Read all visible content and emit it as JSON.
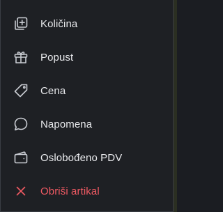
{
  "menu": {
    "items": [
      {
        "id": "quantity",
        "label": "Količina",
        "icon": "add-box-icon"
      },
      {
        "id": "discount",
        "label": "Popust",
        "icon": "gift-icon"
      },
      {
        "id": "price",
        "label": "Cena",
        "icon": "tag-icon"
      },
      {
        "id": "note",
        "label": "Napomena",
        "icon": "comment-icon"
      },
      {
        "id": "vat-exempt",
        "label": "Oslobođeno PDV",
        "icon": "wallet-icon"
      },
      {
        "id": "delete",
        "label": "Obriši artikal",
        "icon": "close-icon"
      }
    ]
  },
  "colors": {
    "background": "#1e2024",
    "text": "#e8e9ec",
    "icon": "#c9ccd2",
    "danger": "#f05a63"
  }
}
